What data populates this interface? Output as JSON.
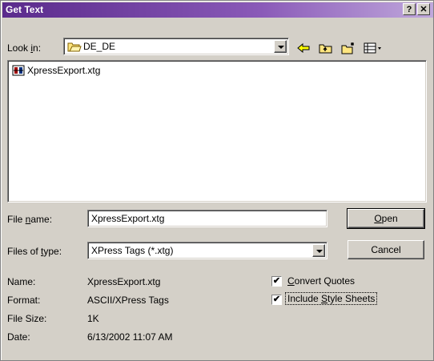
{
  "window": {
    "title": "Get Text",
    "help_label": "?",
    "close_label": "✕"
  },
  "lookin": {
    "label_pre": "Look ",
    "label_accel": "i",
    "label_post": "n:",
    "value": "DE_DE"
  },
  "files": [
    {
      "name": "XpressExport.xtg",
      "icon": "xtg-file-icon"
    }
  ],
  "filename": {
    "label_pre": "File ",
    "label_accel": "n",
    "label_post": "ame:",
    "value": "XpressExport.xtg"
  },
  "filetype": {
    "label_pre": "Files of ",
    "label_accel": "t",
    "label_post": "ype:",
    "value": "XPress Tags (*.xtg)"
  },
  "buttons": {
    "open_accel": "O",
    "open_rest": "pen",
    "cancel": "Cancel"
  },
  "info": {
    "name_label": "Name:",
    "name_value": "XpressExport.xtg",
    "format_label": "Format:",
    "format_value": "ASCII/XPress Tags",
    "size_label": "File Size:",
    "size_value": "1K",
    "date_label": "Date:",
    "date_value": "6/13/2002 11:07 AM"
  },
  "options": {
    "convert_accel": "C",
    "convert_rest": "onvert Quotes",
    "convert_checked": "✔",
    "include_pre": "Include ",
    "include_accel": "S",
    "include_post": "tyle Sheets",
    "include_checked": "✔"
  },
  "toolbar": {
    "back": "back-arrow-icon",
    "up": "up-folder-icon",
    "newfolder": "new-folder-icon",
    "views": "view-menu-icon"
  },
  "colors": {
    "title_start": "#5a2a8c",
    "dialog_bg": "#d4d0c8"
  }
}
